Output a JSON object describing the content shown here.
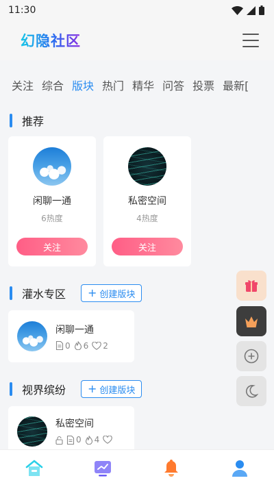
{
  "status_bar": {
    "time": "11:30"
  },
  "header": {
    "brand": "幻隐社区"
  },
  "tabs": [
    "关注",
    "综合",
    "版块",
    "热门",
    "精华",
    "问答",
    "投票",
    "最新["
  ],
  "sections": {
    "recommend": {
      "title": "推荐",
      "cards": [
        {
          "name": "闲聊一通",
          "heat": "6热度",
          "follow_label": "关注",
          "avatar": "sky-icon"
        },
        {
          "name": "私密空间",
          "heat": "4热度",
          "follow_label": "关注",
          "avatar": "dark-lines-icon"
        }
      ]
    },
    "water": {
      "title": "灌水专区",
      "create_label": "创建版块",
      "boards": [
        {
          "name": "闲聊一通",
          "posts": "0",
          "hot": "6",
          "likes": "2"
        }
      ]
    },
    "vision": {
      "title": "视界缤纷",
      "create_label": "创建版块",
      "boards": [
        {
          "name": "私密空间",
          "posts": "0",
          "hot": "4",
          "likes": ""
        }
      ]
    }
  },
  "float_buttons": [
    "gift-icon",
    "crown-icon",
    "plus-circle-icon",
    "moon-icon"
  ],
  "bottom_nav": [
    "home-icon",
    "trend-icon",
    "bell-icon",
    "user-icon"
  ],
  "colors": {
    "accent": "#2a8cf0",
    "follow_start": "#ff5e86",
    "follow_end": "#ff8a9e",
    "bell": "#ff7a2e",
    "trend": "#6a5cf6"
  }
}
